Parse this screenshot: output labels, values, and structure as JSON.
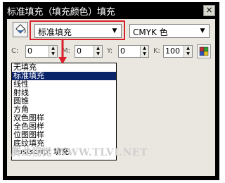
{
  "window": {
    "title": "标准填充（填充颜色）填充",
    "close_symbol": "×"
  },
  "toolbar": {
    "fill_type": {
      "value": "标准填充",
      "options": [
        "无填充",
        "标准填充",
        "线性",
        "射线",
        "圆锥",
        "方角",
        "双色图样",
        "全色图样",
        "位图图样",
        "底纹填充",
        "Postscript 填充"
      ],
      "selected_index": 1
    },
    "color_model": {
      "value": "CMYK 色"
    }
  },
  "cmyk": {
    "c": {
      "label": "C:",
      "value": "0"
    },
    "m": {
      "label": "M:",
      "value": "0"
    },
    "y": {
      "label": "Y:",
      "value": "0"
    },
    "k": {
      "label": "K:",
      "value": "100"
    }
  },
  "watermark": {
    "text": "腾龙视觉 WWW.TLVI.NET"
  },
  "colors": {
    "highlight": "#d8212a",
    "selection": "#0a246a",
    "panel_bg": "#e9e7df"
  }
}
